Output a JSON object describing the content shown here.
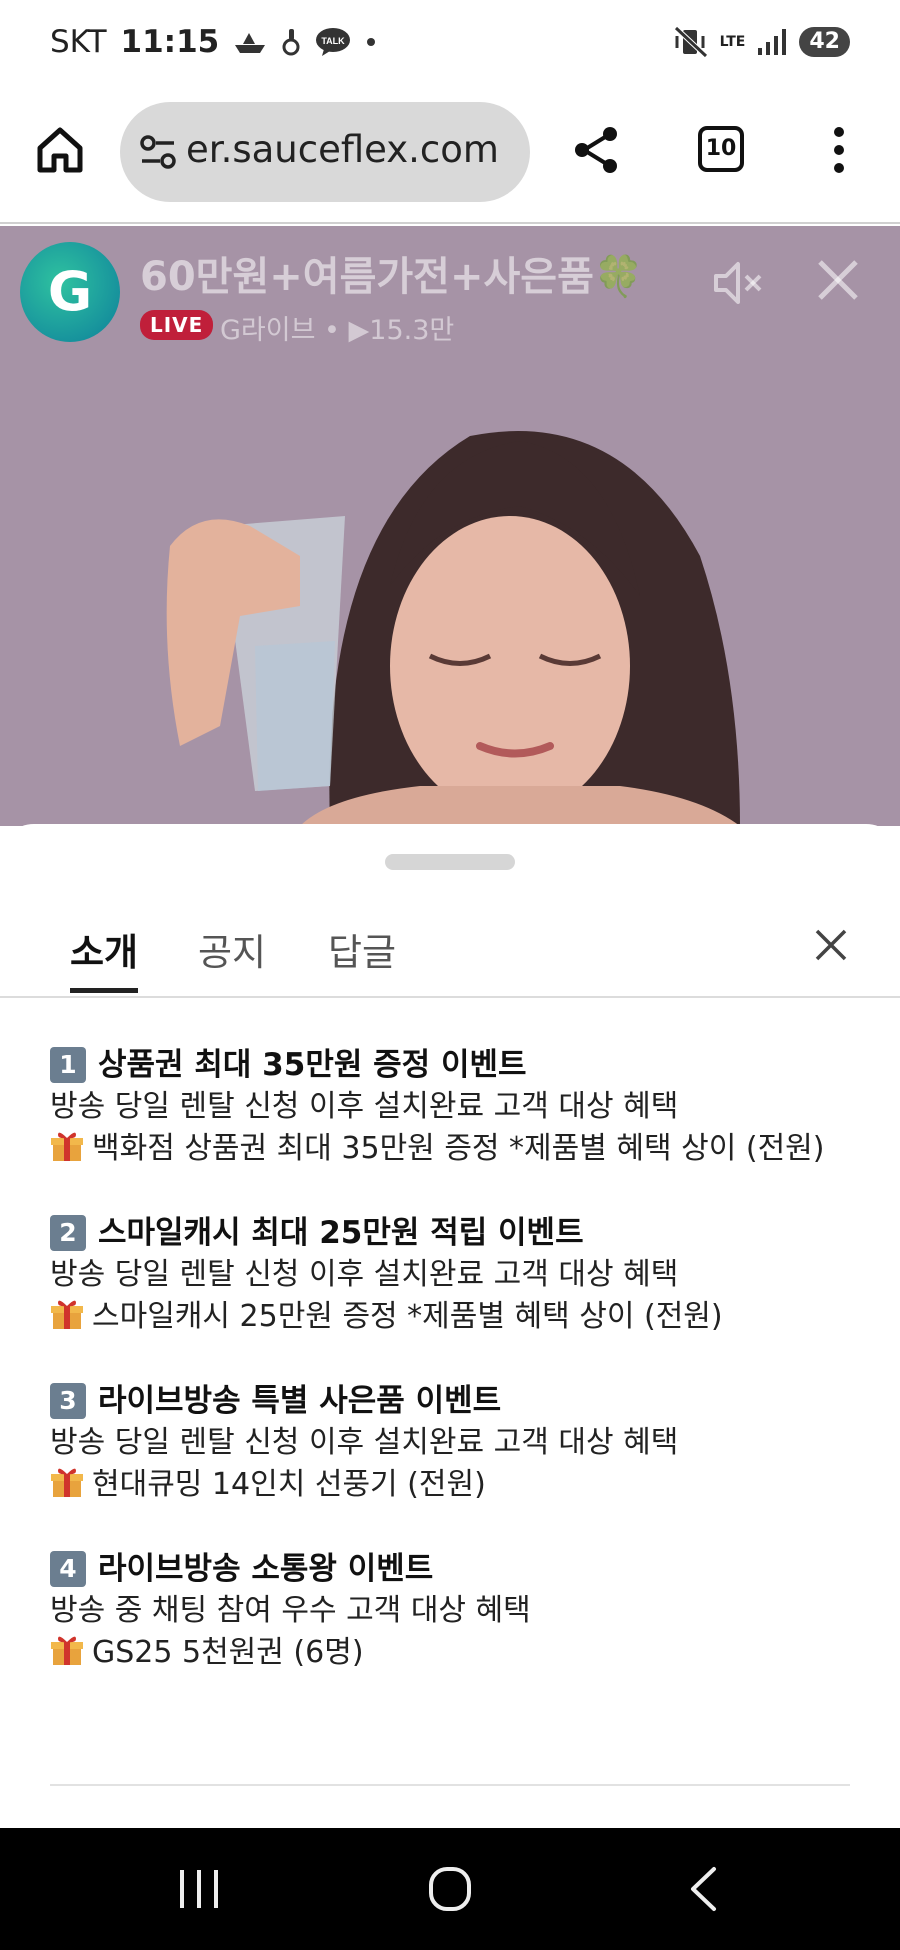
{
  "status_bar": {
    "carrier": "SKT",
    "time": "11:15",
    "notification_icons": [
      "boat-icon",
      "hand-icon",
      "talk-icon",
      "dot-icon"
    ],
    "talk_icon_label": "TALK",
    "network_label": "LTE",
    "battery": "42"
  },
  "browser": {
    "url": "er.sauceflex.com",
    "tab_count": "10"
  },
  "video": {
    "channel_logo": "G",
    "title": "60만원+여름가전+사은품🍀",
    "live_badge": "LIVE",
    "meta": "G라이브 • ▶15.3만"
  },
  "sheet": {
    "tabs": [
      {
        "label": "소개",
        "active": true
      },
      {
        "label": "공지",
        "active": false
      },
      {
        "label": "답글",
        "active": false
      }
    ],
    "events": [
      {
        "number": "1",
        "title": "상품권 최대 35만원 증정 이벤트",
        "condition": "방송 당일 렌탈 신청 이후 설치완료 고객 대상 혜택",
        "benefit": "백화점 상품권 최대 35만원 증정 *제품별 혜택 상이 (전원)"
      },
      {
        "number": "2",
        "title": "스마일캐시 최대 25만원 적립 이벤트",
        "condition": "방송 당일 렌탈 신청 이후 설치완료 고객 대상 혜택",
        "benefit": "스마일캐시 25만원 증정 *제품별 혜택 상이 (전원)"
      },
      {
        "number": "3",
        "title": "라이브방송 특별 사은품 이벤트",
        "condition": "방송 당일 렌탈 신청 이후 설치완료 고객 대상 혜택",
        "benefit": "현대큐밍 14인치 선풍기 (전원)"
      },
      {
        "number": "4",
        "title": "라이브방송 소통왕 이벤트",
        "condition": "방송 중 채팅 참여 우수 고객 대상 혜택",
        "benefit": "GS25 5천원권 (6명)"
      }
    ]
  },
  "colors": {
    "live_red": "#c01f3a",
    "video_bg": "#a693a6",
    "number_box": "#6b7e90"
  }
}
